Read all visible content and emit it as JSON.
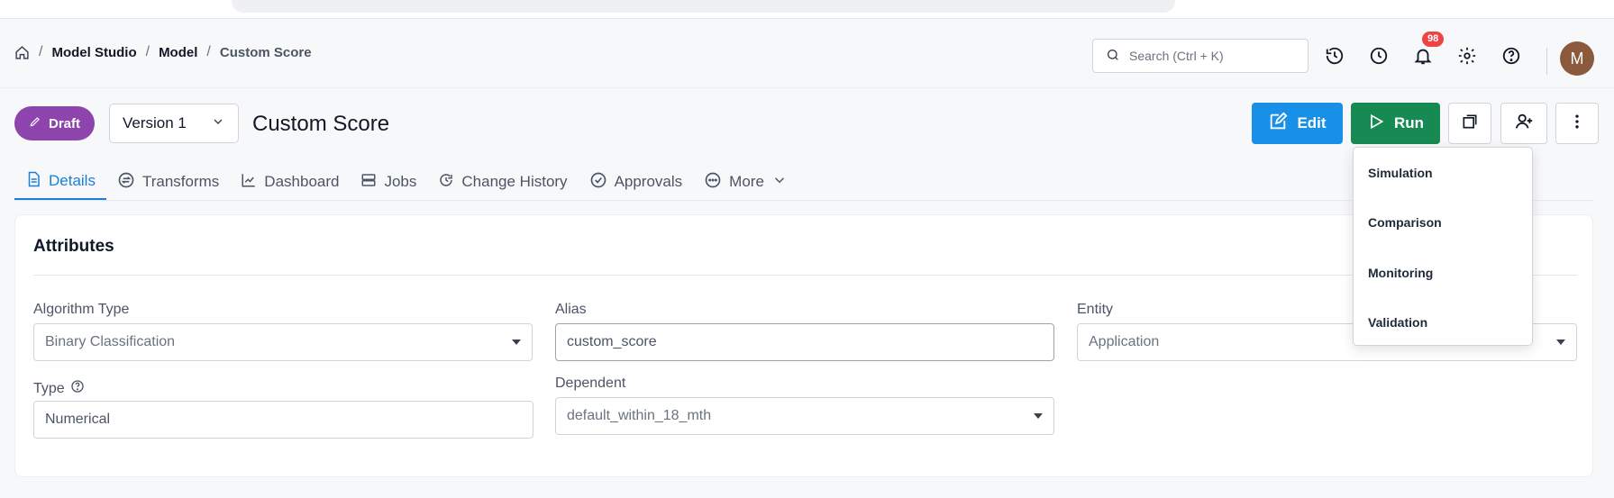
{
  "breadcrumb": {
    "items": [
      "Model Studio",
      "Model",
      "Custom Score"
    ],
    "separator": "/"
  },
  "search": {
    "placeholder": "Search (Ctrl + K)"
  },
  "header_icons": [
    "history-icon",
    "clock-icon",
    "bell-icon",
    "gear-icon",
    "help-icon"
  ],
  "notifications": {
    "count": "98"
  },
  "user": {
    "avatar_initial": "M",
    "avatar_color": "#8b5a3c"
  },
  "status_badge": {
    "label": "Draft",
    "color": "#8e44ad"
  },
  "version_select": {
    "value": "Version 1"
  },
  "page_title": "Custom Score",
  "toolbar": {
    "edit_label": "Edit",
    "run_label": "Run",
    "edit_color": "#1890e8",
    "run_color": "#168a52"
  },
  "tabs": [
    {
      "label": "Details",
      "icon": "document-icon",
      "active": true
    },
    {
      "label": "Transforms",
      "icon": "transform-icon"
    },
    {
      "label": "Dashboard",
      "icon": "chart-icon"
    },
    {
      "label": "Jobs",
      "icon": "server-icon"
    },
    {
      "label": "Change History",
      "icon": "history-icon"
    },
    {
      "label": "Approvals",
      "icon": "check-circle-icon"
    },
    {
      "label": "More",
      "icon": "more-icon"
    }
  ],
  "attributes": {
    "title": "Attributes",
    "algorithm_type": {
      "label": "Algorithm Type",
      "value": "Binary Classification"
    },
    "alias": {
      "label": "Alias",
      "value": "custom_score"
    },
    "entity": {
      "label": "Entity",
      "value": "Application"
    },
    "type": {
      "label": "Type",
      "value": "Numerical"
    },
    "dependent": {
      "label": "Dependent",
      "value": "default_within_18_mth"
    }
  },
  "run_menu": {
    "items": [
      "Simulation",
      "Comparison",
      "Monitoring",
      "Validation"
    ]
  }
}
